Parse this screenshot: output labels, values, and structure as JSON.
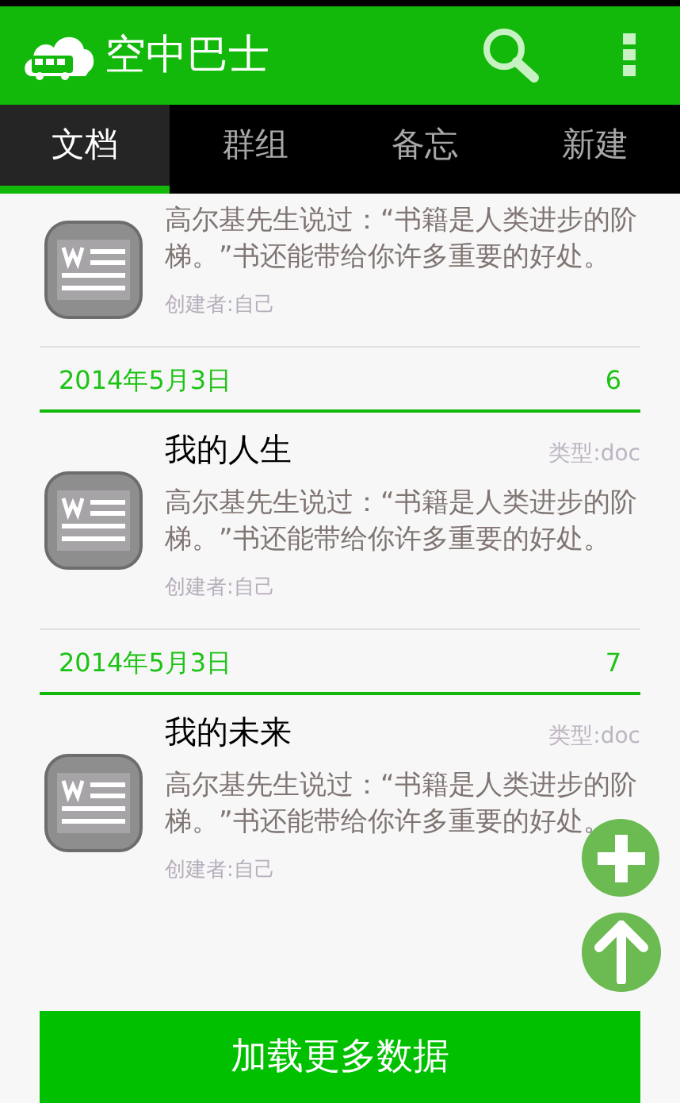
{
  "app_bar": {
    "title": "空中巴士"
  },
  "tabs": [
    {
      "label": "文档",
      "selected": true
    },
    {
      "label": "群组",
      "selected": false
    },
    {
      "label": "备忘",
      "selected": false
    },
    {
      "label": "新建",
      "selected": false
    }
  ],
  "documents": [
    {
      "description": "高尔基先生说过：“书籍是人类进步的阶梯。”书还能带给你许多重要的好处。",
      "creator": "创建者:自己"
    },
    {
      "date": "2014年5月3日",
      "count": "6",
      "title": "我的人生",
      "type": "类型:doc",
      "description": "高尔基先生说过：“书籍是人类进步的阶梯。”书还能带给你许多重要的好处。",
      "creator": "创建者:自己"
    },
    {
      "date": "2014年5月3日",
      "count": "7",
      "title": "我的未来",
      "type": "类型:doc",
      "description": "高尔基先生说过：“书籍是人类进步的阶梯。”书还能带给你许多重要的好处。",
      "creator": "创建者:自己"
    }
  ],
  "load_more_button": "加载更多数据"
}
